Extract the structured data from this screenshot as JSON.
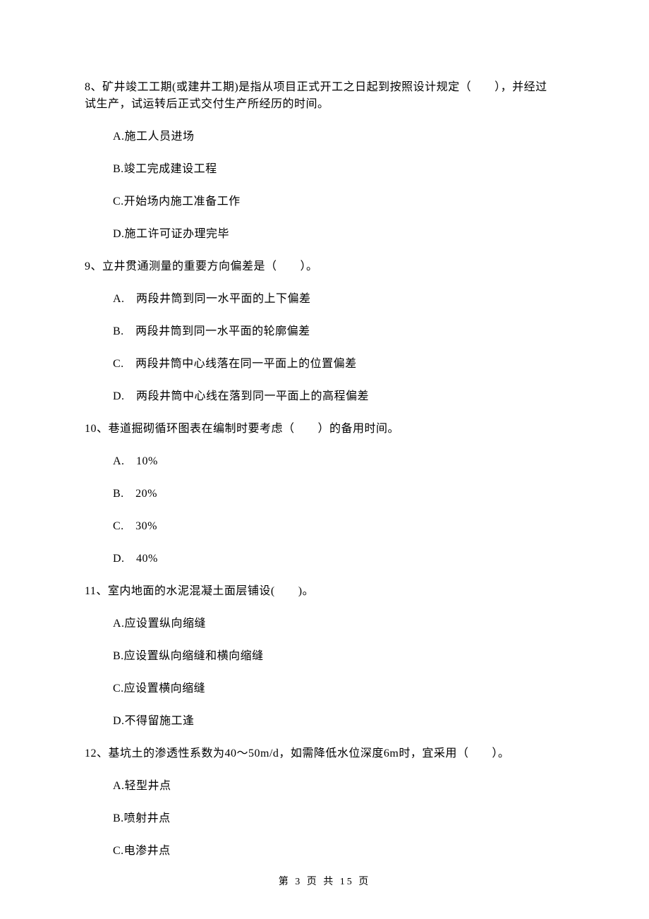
{
  "questions": [
    {
      "number": "8",
      "stem_a": "8、矿井竣工工期(或建井工期)是指从项目正式开工之日起到按照设计规定（　　），并经过",
      "stem_b": "试生产，试运转后正式交付生产所经历的时间。",
      "options": [
        "A.施工人员进场",
        "B.竣工完成建设工程",
        "C.开始场内施工准备工作",
        "D.施工许可证办理完毕"
      ]
    },
    {
      "number": "9",
      "stem": "9、立井贯通测量的重要方向偏差是（　　）。",
      "options": [
        "A.　两段井筒到同一水平面的上下偏差",
        "B.　两段井筒到同一水平面的轮廓偏差",
        "C.　两段井筒中心线落在同一平面上的位置偏差",
        "D.　两段井筒中心线在落到同一平面上的高程偏差"
      ]
    },
    {
      "number": "10",
      "stem": "10、巷道掘砌循环图表在编制时要考虑（　　）的备用时间。",
      "options": [
        "A.　10%",
        "B.　20%",
        "C.　30%",
        "D.　40%"
      ]
    },
    {
      "number": "11",
      "stem": "11、室内地面的水泥混凝土面层铺设(　　)。",
      "options": [
        "A.应设置纵向缩缝",
        "B.应设置纵向缩缝和横向缩缝",
        "C.应设置横向缩缝",
        "D.不得留施工逢"
      ]
    },
    {
      "number": "12",
      "stem": "12、基坑土的渗透性系数为40～50m/d，如需降低水位深度6m时，宜采用（　　）。",
      "options": [
        "A.轻型井点",
        "B.喷射井点",
        "C.电渗井点"
      ]
    }
  ],
  "footer": "第 3 页 共 15 页"
}
